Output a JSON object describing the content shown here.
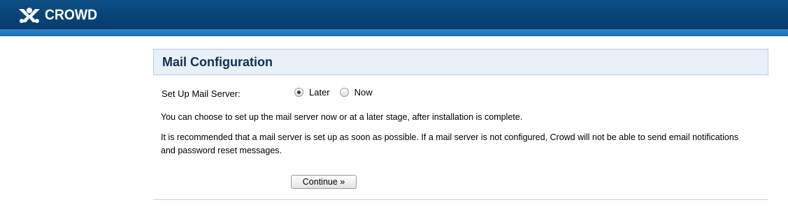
{
  "header": {
    "logo_icon": "crowd-logo-icon",
    "logo_text": "CROWD"
  },
  "panel": {
    "title": "Mail Configuration"
  },
  "form": {
    "mail_server_label": "Set Up Mail Server:",
    "options": [
      {
        "label": "Later",
        "selected": true
      },
      {
        "label": "Now",
        "selected": false
      }
    ]
  },
  "content": {
    "paragraph1": "You can choose to set up the mail server now or at a later stage, after installation is complete.",
    "paragraph2": "It is recommended that a mail server is set up as soon as possible. If a mail server is not configured, Crowd will not be able to send email notifications and password reset messages."
  },
  "actions": {
    "continue_label": "Continue »"
  }
}
